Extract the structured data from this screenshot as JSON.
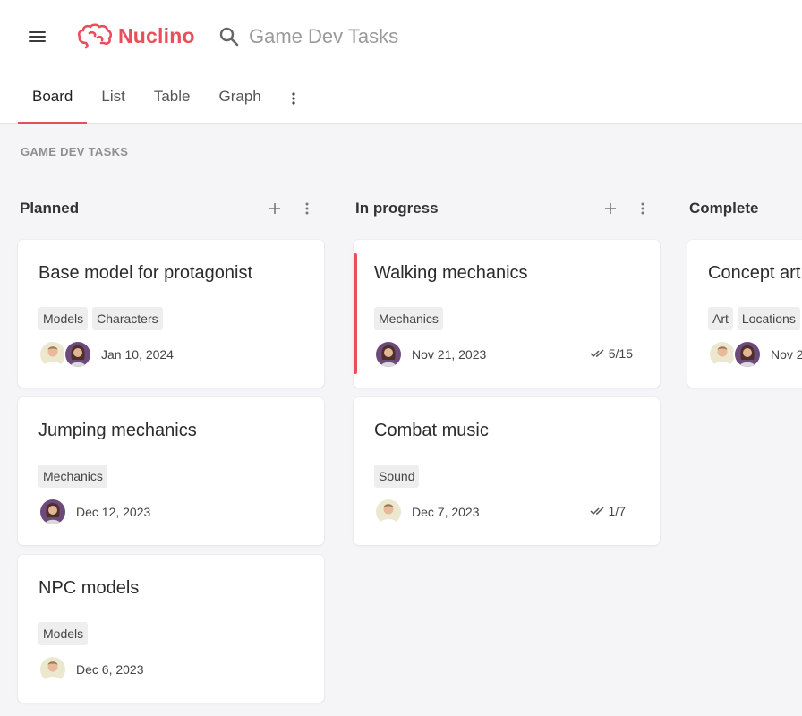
{
  "app": {
    "name": "Nuclino",
    "brand_color": "#e94e5b"
  },
  "header": {
    "search_text": "Game Dev Tasks"
  },
  "tabs": [
    {
      "label": "Board",
      "active": true
    },
    {
      "label": "List",
      "active": false
    },
    {
      "label": "Table",
      "active": false
    },
    {
      "label": "Graph",
      "active": false
    }
  ],
  "breadcrumb": "GAME DEV TASKS",
  "columns": [
    {
      "title": "Planned",
      "cards": [
        {
          "title": "Base model for protagonist",
          "tags": [
            "Models",
            "Characters"
          ],
          "avatars": [
            "male",
            "female"
          ],
          "date": "Jan 10, 2024"
        },
        {
          "title": "Jumping mechanics",
          "tags": [
            "Mechanics"
          ],
          "avatars": [
            "female"
          ],
          "date": "Dec 12, 2023"
        },
        {
          "title": "NPC models",
          "tags": [
            "Models"
          ],
          "avatars": [
            "male"
          ],
          "date": "Dec 6, 2023"
        }
      ]
    },
    {
      "title": "In progress",
      "cards": [
        {
          "title": "Walking mechanics",
          "tags": [
            "Mechanics"
          ],
          "avatars": [
            "female"
          ],
          "date": "Nov 21, 2023",
          "checklist": "5/15",
          "accent": true
        },
        {
          "title": "Combat music",
          "tags": [
            "Sound"
          ],
          "avatars": [
            "male"
          ],
          "date": "Dec 7, 2023",
          "checklist": "1/7"
        }
      ]
    },
    {
      "title": "Complete",
      "cards": [
        {
          "title": "Concept art",
          "tags": [
            "Art",
            "Locations"
          ],
          "avatars": [
            "male",
            "female"
          ],
          "date": "Nov 2"
        }
      ]
    }
  ]
}
